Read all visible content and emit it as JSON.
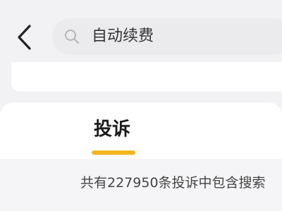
{
  "search": {
    "query": "自动续费"
  },
  "tabs": [
    {
      "label": "投诉",
      "active": true
    }
  ],
  "results": {
    "summary": "共有227950条投诉中包含搜索"
  },
  "colors": {
    "accent": "#f2b51c",
    "background": "#f2f2f4",
    "card": "#ffffff"
  },
  "icons": {
    "back": "chevron-left-icon",
    "search": "search-icon"
  }
}
